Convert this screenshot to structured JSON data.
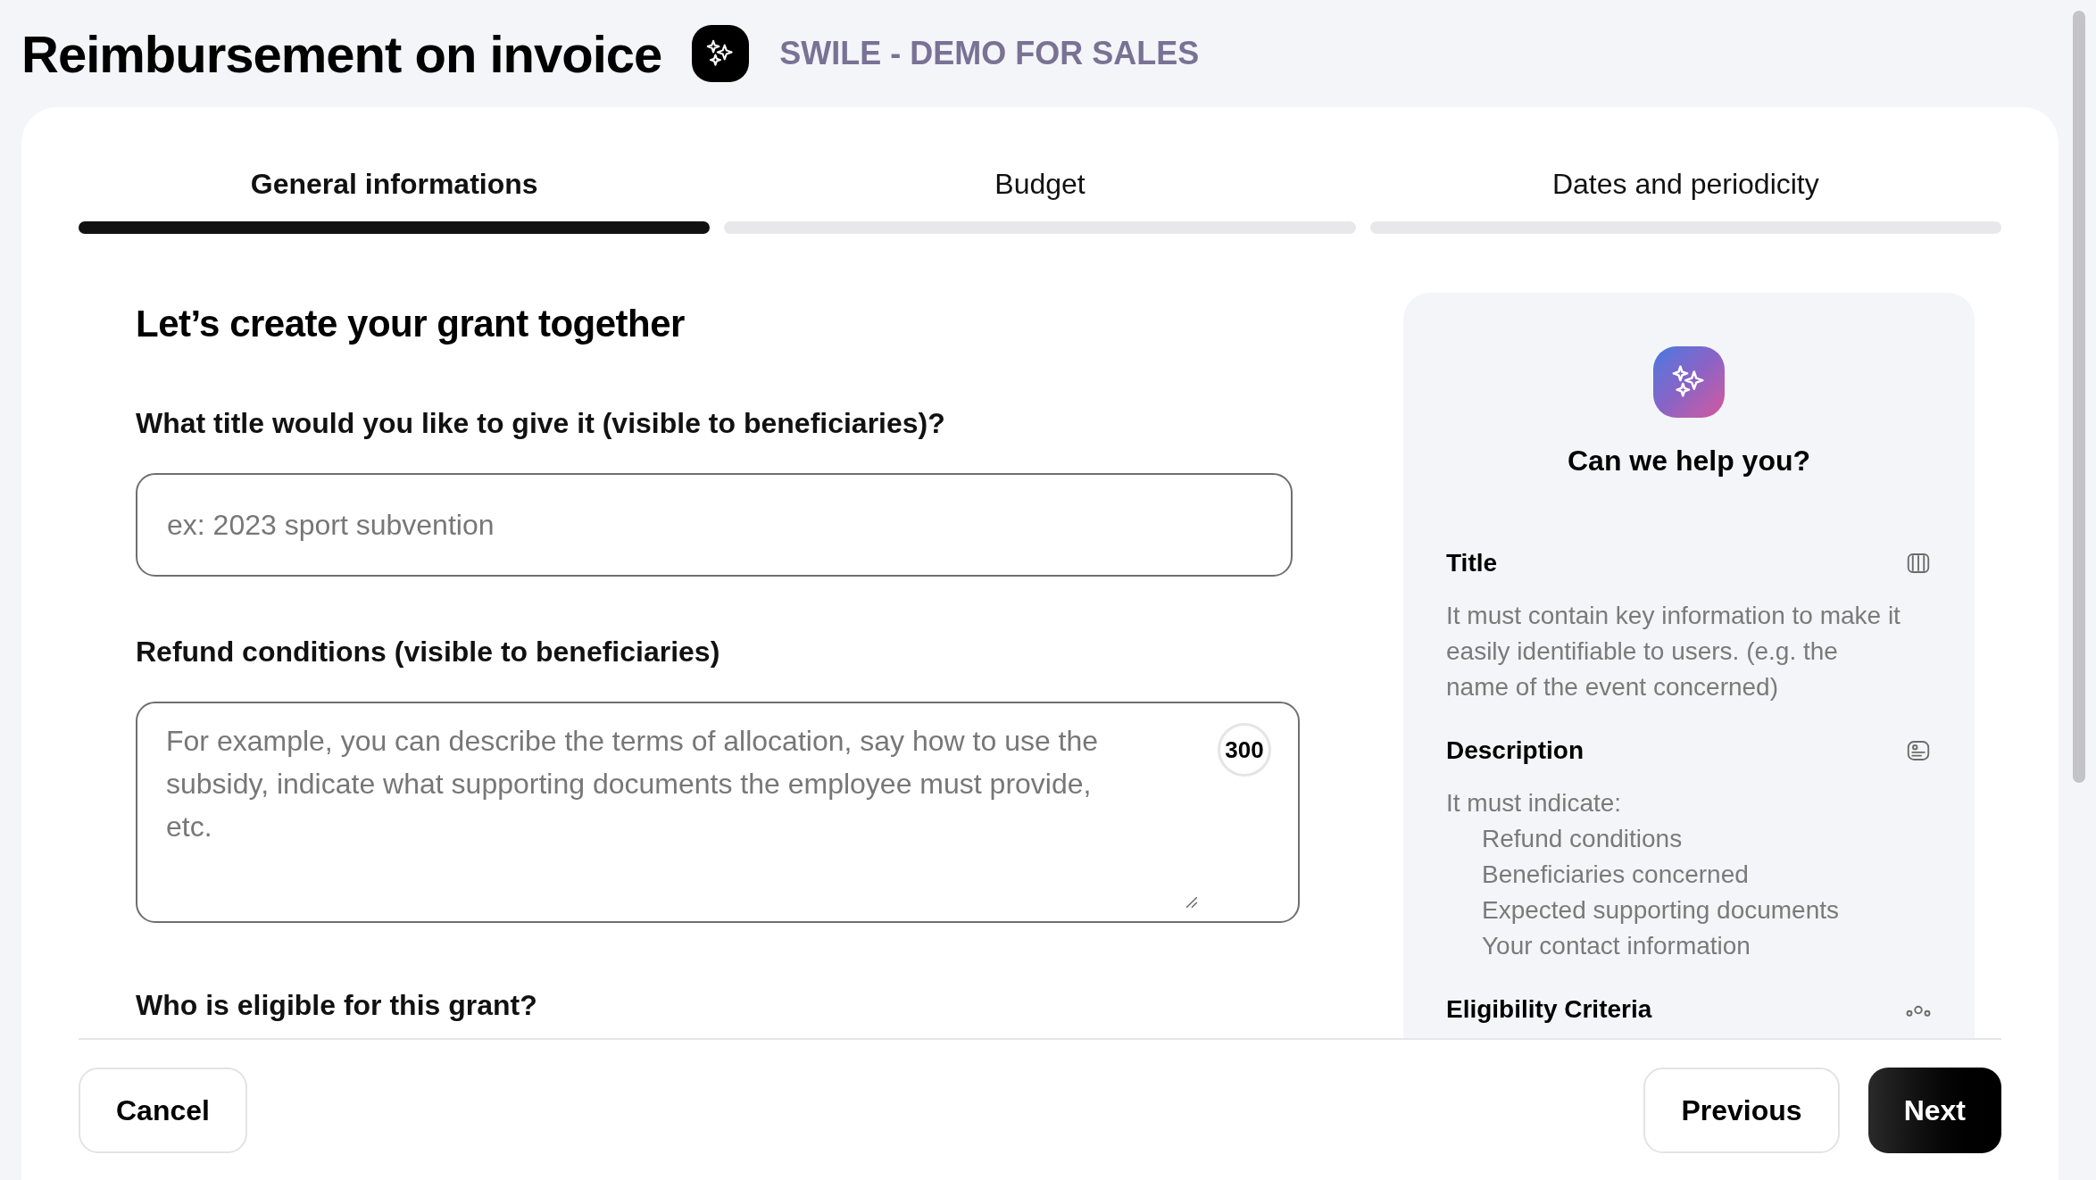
{
  "header": {
    "title": "Reimbursement on invoice",
    "company": "SWILE - DEMO FOR SALES"
  },
  "steps": [
    {
      "label": "General informations",
      "selected": true
    },
    {
      "label": "Budget",
      "selected": false
    },
    {
      "label": "Dates and periodicity",
      "selected": false
    }
  ],
  "form": {
    "heading": "Let’s create your grant together",
    "fields": [
      {
        "kind": "input",
        "label": "What title would you like to give it (visible to beneficiaries)?",
        "placeholder": "ex: 2023 sport subvention"
      },
      {
        "kind": "textarea",
        "label": "Refund conditions (visible to beneficiaries)",
        "placeholder": "For example, you can describe the terms of allocation, say how to use the subsidy, indicate what supporting documents the employee must provide, etc.",
        "counter": "300"
      },
      {
        "kind": "section",
        "label": "Who is eligible for this grant?"
      }
    ]
  },
  "help": {
    "title": "Can we help you?",
    "sections": [
      {
        "title": "Title",
        "kind": "book",
        "text": "It must contain key information to make it easily identifiable to users. (e.g. the name of the event concerned)"
      },
      {
        "title": "Description",
        "kind": "card",
        "intro": "It must indicate:",
        "items": [
          "Refund conditions",
          "Beneficiaries concerned",
          "Expected supporting documents",
          "Your contact information"
        ]
      },
      {
        "title": "Eligibility Criteria",
        "kind": "people"
      }
    ]
  },
  "footer": {
    "cancel": "Cancel",
    "previous": "Previous",
    "next": "Next"
  }
}
